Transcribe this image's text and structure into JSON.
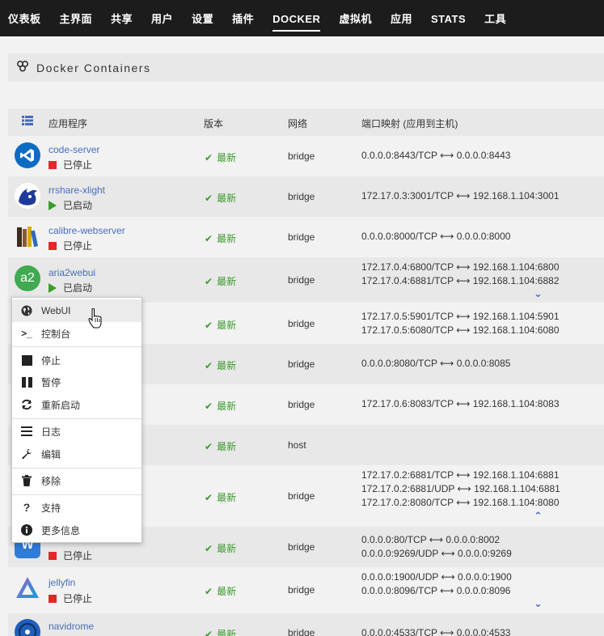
{
  "nav": [
    "仪表板",
    "主界面",
    "共享",
    "用户",
    "设置",
    "插件",
    "DOCKER",
    "虚拟机",
    "应用",
    "STATS",
    "工具"
  ],
  "nav_active": "DOCKER",
  "section": {
    "title": "Docker Containers"
  },
  "table": {
    "headers": {
      "app": "应用程序",
      "version": "版本",
      "network": "网络",
      "ports": "端口映射 (应用到主机)"
    }
  },
  "rows": [
    {
      "name": "code-server",
      "status": "已停止",
      "running": false,
      "version": "最新",
      "network": "bridge",
      "ports": [
        "0.0.0.0:8443/TCP ⟷ 0.0.0.0:8443"
      ]
    },
    {
      "name": "rrshare-xlight",
      "status": "已启动",
      "running": true,
      "version": "最新",
      "network": "bridge",
      "ports": [
        "172.17.0.3:3001/TCP ⟷ 192.168.1.104:3001"
      ]
    },
    {
      "name": "calibre-webserver",
      "status": "已停止",
      "running": false,
      "version": "最新",
      "network": "bridge",
      "ports": [
        "0.0.0.0:8000/TCP ⟷ 0.0.0.0:8000"
      ]
    },
    {
      "name": "aria2webui",
      "status": "已启动",
      "running": true,
      "version": "最新",
      "network": "bridge",
      "ports": [
        "172.17.0.4:6800/TCP ⟷ 192.168.1.104:6800",
        "172.17.0.4:6881/TCP ⟷ 192.168.1.104:6882"
      ]
    },
    {
      "name": "",
      "status": "",
      "running": true,
      "version": "最新",
      "network": "bridge",
      "ports": [
        "172.17.0.5:5901/TCP ⟷ 192.168.1.104:5901",
        "172.17.0.5:6080/TCP ⟷ 192.168.1.104:6080"
      ]
    },
    {
      "name": "",
      "status": "",
      "running": false,
      "version": "最新",
      "network": "bridge",
      "ports": [
        "0.0.0.0:8080/TCP ⟷ 0.0.0.0:8085"
      ]
    },
    {
      "name": "",
      "status": "",
      "running": true,
      "version": "最新",
      "network": "bridge",
      "ports": [
        "172.17.0.6:8083/TCP ⟷ 192.168.1.104:8083"
      ]
    },
    {
      "name": "",
      "status": "",
      "running": true,
      "version": "最新",
      "network": "host",
      "ports": []
    },
    {
      "name": "",
      "status": "",
      "running": true,
      "version": "最新",
      "network": "bridge",
      "ports": [
        "172.17.0.2:6881/TCP ⟷ 192.168.1.104:6881",
        "172.17.0.2:6881/UDP ⟷ 192.168.1.104:6881",
        "172.17.0.2:8080/TCP ⟷ 192.168.1.104:8080"
      ]
    },
    {
      "name": "",
      "status": "已停止",
      "running": false,
      "version": "最新",
      "network": "bridge",
      "ports": [
        "0.0.0.0:80/TCP ⟷ 0.0.0.0:8002",
        "0.0.0.0:9269/UDP ⟷ 0.0.0.0:9269"
      ]
    },
    {
      "name": "jellyfin",
      "status": "已停止",
      "running": false,
      "version": "最新",
      "network": "bridge",
      "ports": [
        "0.0.0.0:1900/UDP ⟷ 0.0.0.0:1900",
        "0.0.0.0:8096/TCP ⟷ 0.0.0.0:8096"
      ]
    },
    {
      "name": "navidrome",
      "status": "",
      "running": false,
      "version": "最新",
      "network": "bridge",
      "ports": [
        "0.0.0.0:4533/TCP ⟷ 0.0.0.0:4533"
      ]
    }
  ],
  "menu": {
    "webui": "WebUI",
    "console": "控制台",
    "stop": "停止",
    "pause": "暂停",
    "restart": "重新启动",
    "logs": "日志",
    "edit": "编辑",
    "remove": "移除",
    "support": "支持",
    "more_info": "更多信息"
  },
  "colors": {
    "link": "#486dba",
    "ok": "#3c9a2e",
    "stopped": "#e22828",
    "nav_bg": "#1c1c1c"
  }
}
